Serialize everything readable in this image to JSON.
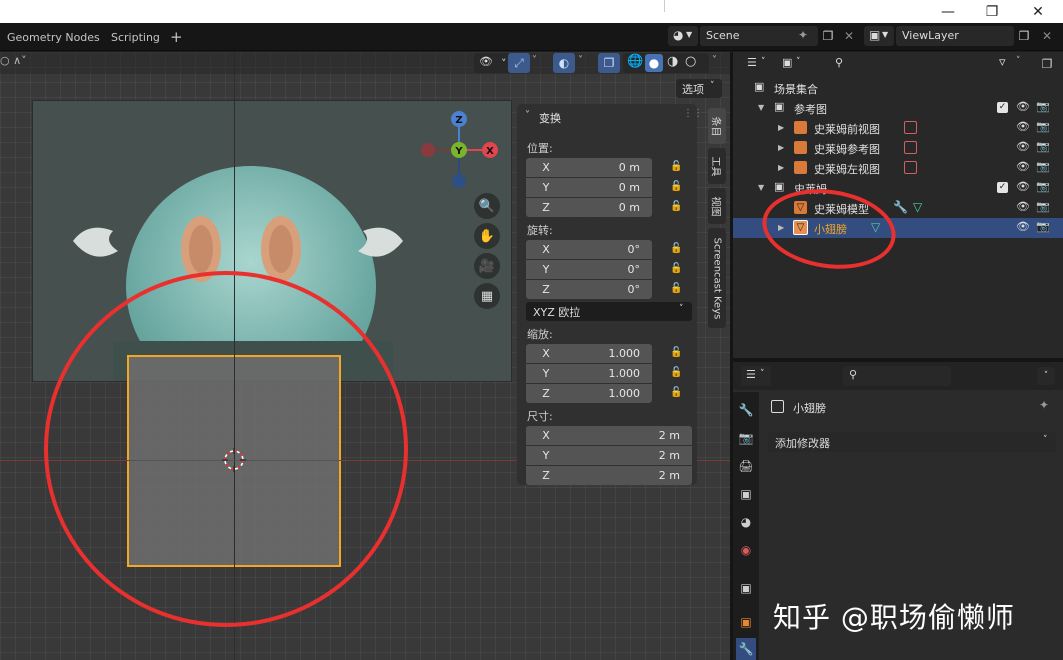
{
  "workspace_tabs": [
    "Geometry Nodes",
    "Scripting"
  ],
  "add_tab": "+",
  "scene": {
    "name": "Scene"
  },
  "view_layer": {
    "name": "ViewLayer"
  },
  "viewport": {
    "options_label": "选项",
    "gizmo": {
      "z": "Z",
      "y": "Y",
      "x": "X"
    },
    "side_tabs": [
      "条目",
      "工具",
      "视图",
      "Screencast Keys"
    ]
  },
  "transform_panel": {
    "title": "变换",
    "location_label": "位置:",
    "location": [
      {
        "axis": "X",
        "value": "0 m"
      },
      {
        "axis": "Y",
        "value": "0 m"
      },
      {
        "axis": "Z",
        "value": "0 m"
      }
    ],
    "rotation_label": "旋转:",
    "rotation": [
      {
        "axis": "X",
        "value": "0°"
      },
      {
        "axis": "Y",
        "value": "0°"
      },
      {
        "axis": "Z",
        "value": "0°"
      }
    ],
    "rotation_mode": "XYZ 欧拉",
    "scale_label": "缩放:",
    "scale": [
      {
        "axis": "X",
        "value": "1.000"
      },
      {
        "axis": "Y",
        "value": "1.000"
      },
      {
        "axis": "Z",
        "value": "1.000"
      }
    ],
    "dimensions_label": "尺寸:",
    "dimensions": [
      {
        "axis": "X",
        "value": "2 m"
      },
      {
        "axis": "Y",
        "value": "2 m"
      },
      {
        "axis": "Z",
        "value": "2 m"
      }
    ]
  },
  "outliner": {
    "root": "场景集合",
    "items": [
      {
        "label": "参考图",
        "type": "collection"
      },
      {
        "label": "史莱姆前视图",
        "type": "empty-image"
      },
      {
        "label": "史莱姆参考图",
        "type": "empty-image"
      },
      {
        "label": "史莱姆左视图",
        "type": "empty-image"
      },
      {
        "label": "史莱姆",
        "type": "collection"
      },
      {
        "label": "史莱姆模型",
        "type": "mesh"
      },
      {
        "label": "小翅膀",
        "type": "mesh",
        "selected": true
      }
    ]
  },
  "properties": {
    "object_name": "小翅膀",
    "add_modifier": "添加修改器"
  },
  "watermark": "知乎 @职场偷懒师",
  "colors": {
    "accent": "#4772b3",
    "selection": "#f5a623",
    "annotation": "#e8302f",
    "active_text": "#f5a623"
  }
}
